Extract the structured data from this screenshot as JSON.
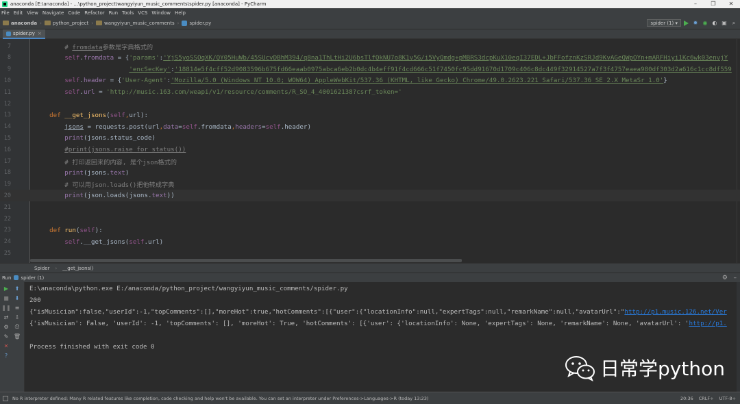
{
  "window": {
    "title": "anaconda [E:\\anaconda] - ...\\python_project\\wangyiyun_music_comments\\spider.py [anaconda] - PyCharm",
    "buttons": [
      "–",
      "❐",
      "✕"
    ]
  },
  "menu": [
    "File",
    "Edit",
    "View",
    "Navigate",
    "Code",
    "Refactor",
    "Run",
    "Tools",
    "VCS",
    "Window",
    "Help"
  ],
  "breadcrumbs": [
    "anaconda",
    "python_project",
    "wangyiyun_music_comments",
    "spider.py"
  ],
  "run_config": "spider (1) ▾",
  "editor_tab": "spider.py",
  "code_lines": [
    {
      "n": "7",
      "segs": [
        [
          "cm",
          "        # "
        ],
        [
          "cm uline",
          "fromdata"
        ],
        [
          "cm",
          "参数是字典格式的"
        ]
      ]
    },
    {
      "n": "8",
      "segs": [
        [
          "self",
          "        self"
        ],
        [
          "plain",
          "."
        ],
        [
          "attr",
          "fromdata"
        ],
        [
          "plain",
          " = {"
        ],
        [
          "strp",
          "'params'"
        ],
        [
          "plain",
          ":"
        ],
        [
          "str",
          "'YjS5yoSSOqXK/QY05HuWb/45SUcvDBhM394/q8na1ThLtHi2U6bsTlfQkNU7o8K1v5G/i5VyQmdg+pMBRS3dcpKuX10eqI37EDL+JbFFofznKzSRJd9KvAGeQWpOYn+mARFHiyi1Kc6wk03envjY"
        ]
      ]
    },
    {
      "n": "9",
      "segs": [
        [
          "plain",
          "                         "
        ],
        [
          "str",
          "'encSecKey'"
        ],
        [
          "plain",
          ":"
        ],
        [
          "str",
          "'18814e5f4cff52d9083596b675fd66eaab0975abca6eb2b0dc4b4eff91f4cd666c51f7450fc95dd91670d1709c406c8dc449f32914527a7f3f4757eaea980df303d2a616c1cc8df559"
        ]
      ]
    },
    {
      "n": "10",
      "segs": [
        [
          "self",
          "        self"
        ],
        [
          "plain",
          "."
        ],
        [
          "attr",
          "header"
        ],
        [
          "plain",
          " = {"
        ],
        [
          "strp",
          "'User-Agent'"
        ],
        [
          "plain",
          ":"
        ],
        [
          "str",
          "'Mozilla/5.0 (Windows NT 10.0; WOW64) AppleWebKit/537.36 (KHTML, like Gecko) Chrome/49.0.2623.221 Safari/537.36 SE 2.X MetaSr 1.0'"
        ],
        [
          "plain",
          "}"
        ]
      ]
    },
    {
      "n": "11",
      "segs": [
        [
          "self",
          "        self"
        ],
        [
          "plain",
          "."
        ],
        [
          "attr",
          "url"
        ],
        [
          "plain",
          " = "
        ],
        [
          "strp",
          "'http://music.163.com/weapi/v1/resource/comments/R_SO_4_400162138?csrf_token='"
        ]
      ]
    },
    {
      "n": "12",
      "segs": []
    },
    {
      "n": "13",
      "segs": [
        [
          "kw",
          "    def "
        ],
        [
          "fn",
          "__get_jsons"
        ],
        [
          "plain",
          "("
        ],
        [
          "self",
          "self"
        ],
        [
          "kw",
          ","
        ],
        [
          "plain",
          "url):"
        ]
      ]
    },
    {
      "n": "14",
      "segs": [
        [
          "plain",
          "        "
        ],
        [
          "plain uline",
          "jsons"
        ],
        [
          "plain",
          " = requests.post(url"
        ],
        [
          "kw",
          ","
        ],
        [
          "attr",
          "data"
        ],
        [
          "plain",
          "="
        ],
        [
          "self",
          "self"
        ],
        [
          "plain",
          ".fromdata"
        ],
        [
          "kw",
          ","
        ],
        [
          "attr",
          "headers"
        ],
        [
          "plain",
          "="
        ],
        [
          "self",
          "self"
        ],
        [
          "plain",
          ".header)"
        ]
      ]
    },
    {
      "n": "15",
      "segs": [
        [
          "plain",
          "        "
        ],
        [
          "attr",
          "print"
        ],
        [
          "plain",
          "(jsons.status_code)"
        ]
      ]
    },
    {
      "n": "16",
      "segs": [
        [
          "cm",
          "        "
        ],
        [
          "cm uline",
          "#print(jsons.raise_for_status())"
        ]
      ]
    },
    {
      "n": "17",
      "segs": [
        [
          "cm",
          "        # 打印返回来的内容, 是个json格式的"
        ]
      ]
    },
    {
      "n": "18",
      "segs": [
        [
          "plain",
          "        "
        ],
        [
          "attr",
          "print"
        ],
        [
          "plain",
          "(jsons."
        ],
        [
          "attr",
          "text"
        ],
        [
          "plain",
          ")"
        ]
      ]
    },
    {
      "n": "19",
      "segs": [
        [
          "cm",
          "        # 可以用json.loads()把他转成字典"
        ]
      ]
    },
    {
      "n": "20",
      "segs": [
        [
          "plain",
          "        "
        ],
        [
          "attr",
          "print"
        ],
        [
          "plain",
          "(json.loads(jsons."
        ],
        [
          "attr",
          "text"
        ],
        [
          "plain",
          "))"
        ]
      ]
    },
    {
      "n": "21",
      "segs": []
    },
    {
      "n": "22",
      "segs": []
    },
    {
      "n": "23",
      "segs": [
        [
          "kw",
          "    def "
        ],
        [
          "fn",
          "run"
        ],
        [
          "plain",
          "("
        ],
        [
          "self",
          "self"
        ],
        [
          "plain",
          "):"
        ]
      ]
    },
    {
      "n": "24",
      "segs": [
        [
          "self",
          "        self"
        ],
        [
          "plain",
          ".__get_jsons("
        ],
        [
          "self",
          "self"
        ],
        [
          "plain",
          ".url)"
        ]
      ]
    },
    {
      "n": "25",
      "segs": []
    }
  ],
  "crumb_bar": {
    "left": "Spider",
    "right": "__get_jsons()"
  },
  "run_bar": {
    "label": "Run",
    "config": "spider (1)"
  },
  "output": {
    "line1": "E:\\anaconda\\python.exe E:/anaconda/python_project/wangyiyun_music_comments/spider.py",
    "line2": "200",
    "line3_text": "{\"isMusician\":false,\"userId\":-1,\"topComments\":[],\"moreHot\":true,\"hotComments\":[{\"user\":{\"locationInfo\":null,\"expertTags\":null,\"remarkName\":null,\"avatarUrl\":\"",
    "line3_link": "http://p1.music.126.net/Ver",
    "line4_text": "{'isMusician': False, 'userId': -1, 'topComments': [], 'moreHot': True, 'hotComments': [{'user': {'locationInfo': None, 'expertTags': None, 'remarkName': None, 'avatarUrl': '",
    "line4_link": "http://p1.",
    "line5": "Process finished with exit code 0"
  },
  "watermark": "日常学python",
  "status": {
    "message": "No R interpreter defined: Many R related features like completion, code checking and help won't be available. You can set an interpreter under Preferences->Languages->R (today 13:23)",
    "position": "20:36",
    "line_sep": "CRLF÷",
    "encoding": "UTF-8÷"
  },
  "colors": {
    "accent": "#4a88c7",
    "run_green": "#4caf50",
    "link": "#287bde"
  }
}
